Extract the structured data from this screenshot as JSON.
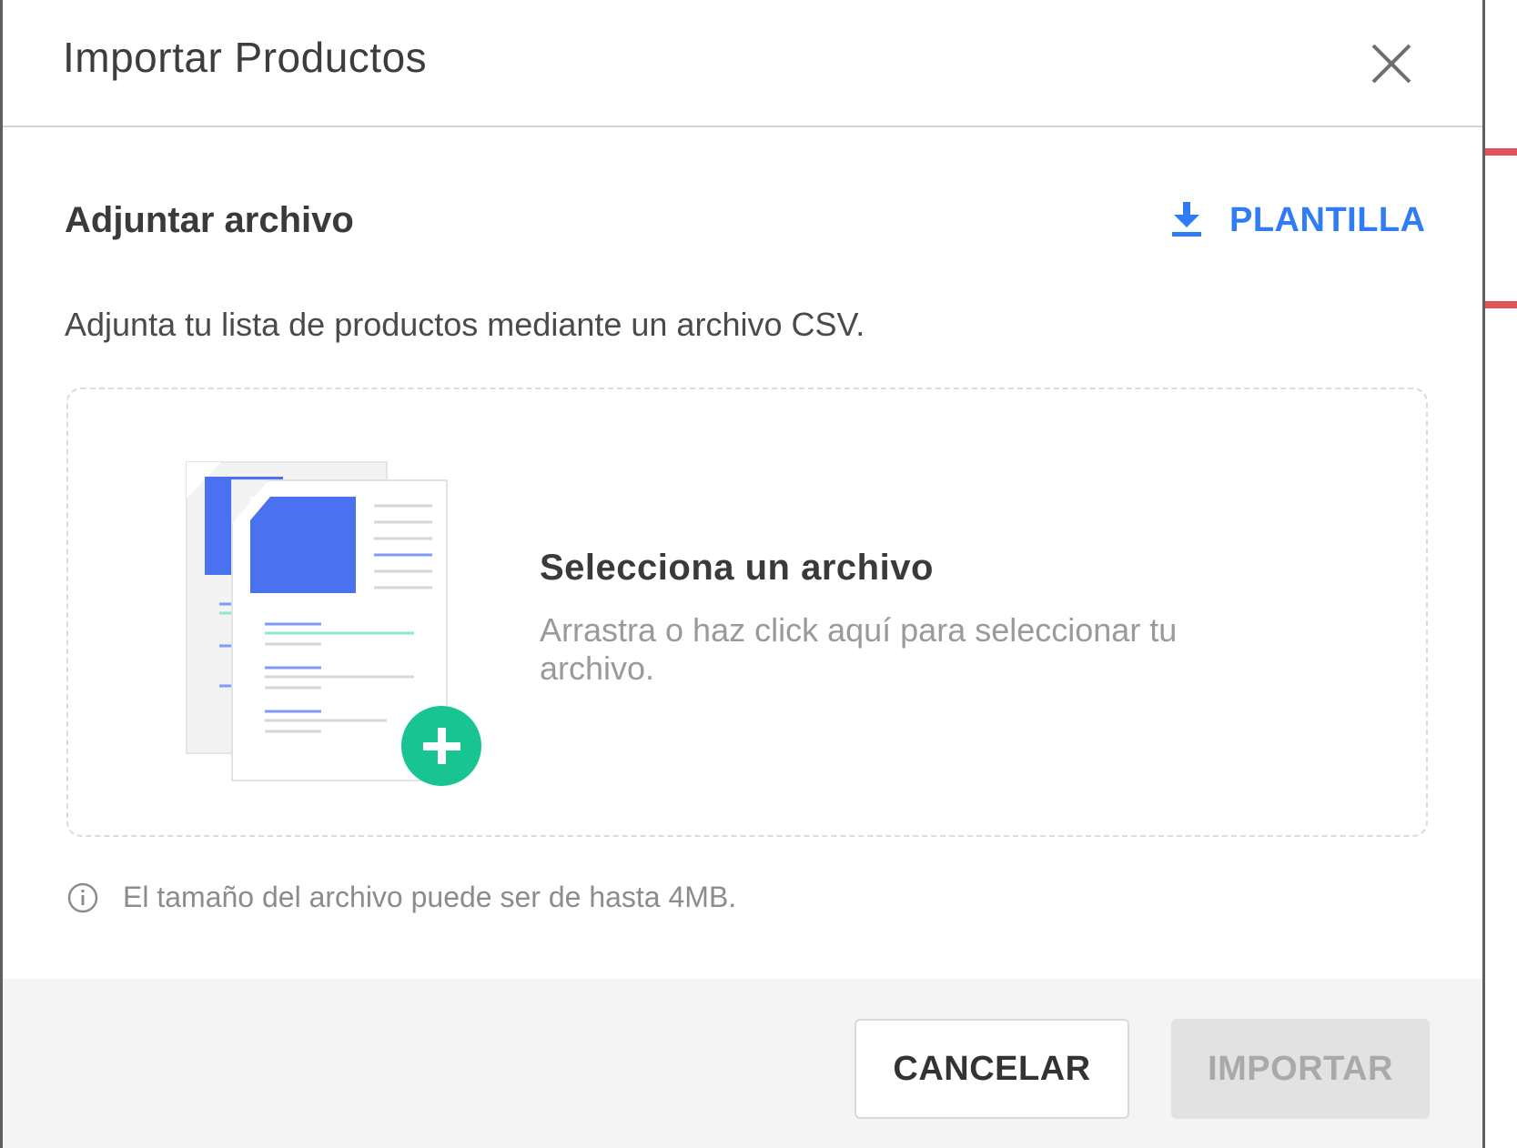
{
  "modal": {
    "title": "Importar Productos",
    "close_icon": "close-icon"
  },
  "attach": {
    "section_title": "Adjuntar archivo",
    "template_label": "PLANTILLA",
    "template_icon": "download-icon",
    "description": "Adjunta tu lista de productos mediante un archivo CSV."
  },
  "dropzone": {
    "title": "Selecciona un archivo",
    "subtitle": "Arrastra o haz click aquí para seleccionar tu archivo.",
    "illustration_icon": "documents-add-icon"
  },
  "info": {
    "icon": "info-icon",
    "text": "El tamaño del archivo puede ser de hasta 4MB."
  },
  "footer": {
    "cancel_label": "CANCELAR",
    "import_label": "IMPORTAR"
  },
  "colors": {
    "accent": "#2f7cf6",
    "highlight": "#e2545a",
    "success": "#17c492",
    "document_blue": "#4a72f0"
  }
}
